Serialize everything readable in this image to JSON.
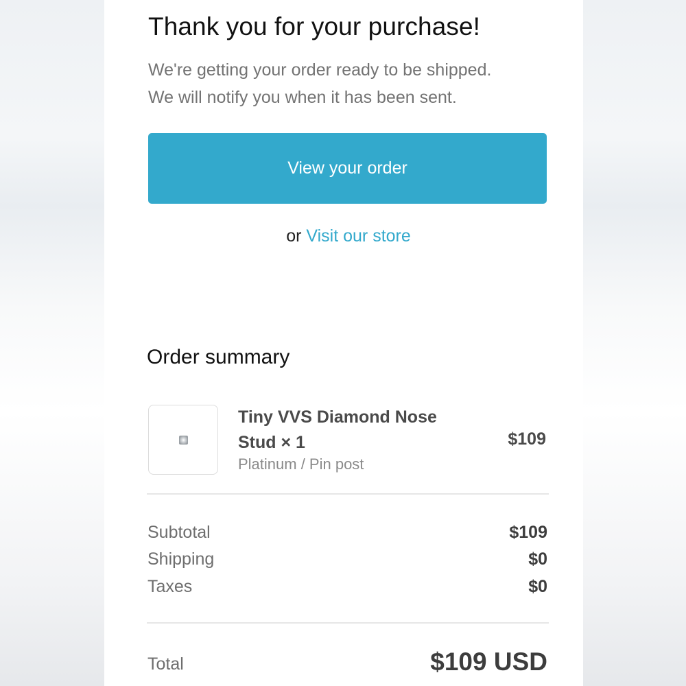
{
  "confirmation": {
    "title": "Thank you for your purchase!",
    "message_line1": "We're getting your order ready to be shipped.",
    "message_line2": "We will notify you when it has been sent.",
    "view_order_label": "View your order",
    "or_text": "or",
    "visit_store_label": "Visit our store"
  },
  "summary": {
    "title": "Order summary",
    "item": {
      "name": "Tiny VVS Diamond Nose Stud × 1",
      "variant": "Platinum / Pin post",
      "price": "$109",
      "thumbnail_icon": "diamond-stud-icon"
    },
    "costs": [
      {
        "label": "Subtotal",
        "value": "$109"
      },
      {
        "label": "Shipping",
        "value": "$0"
      },
      {
        "label": "Taxes",
        "value": "$0"
      }
    ],
    "total_label": "Total",
    "total_value": "$109 USD"
  },
  "colors": {
    "accent": "#33a9cc"
  }
}
